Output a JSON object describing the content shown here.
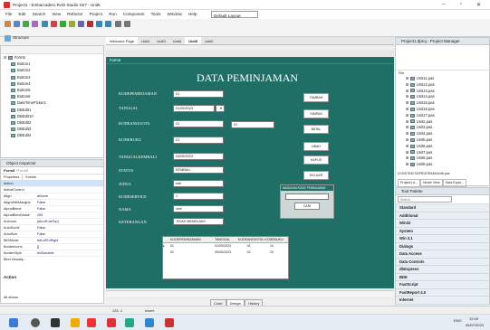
{
  "window": {
    "title": "Project1 - Embarcadero RAD Studio XE7 - Unit5"
  },
  "menu": [
    "File",
    "Edit",
    "Search",
    "View",
    "Refactor",
    "Project",
    "Run",
    "Component",
    "Tools",
    "Window",
    "Help"
  ],
  "toolbar": {
    "layout_combo": "Default Layout"
  },
  "tabs": [
    "Welcome Page",
    "Unit1",
    "Unit3",
    "Unit4",
    "Unit5",
    "Unit2"
  ],
  "structure": {
    "title": "Structure",
    "root": "Form5",
    "items": [
      "Button1",
      "Button2",
      "Button3",
      "Button4",
      "Button5",
      "Button6",
      "DateTimePicker1",
      "DBEdit1",
      "DBEdit10",
      "DBEdit2",
      "DBEdit3",
      "DBEdit4"
    ]
  },
  "inspector": {
    "title": "Object Inspector",
    "object": "Form5",
    "object_type": "TForm5",
    "tabs": [
      "Properties",
      "Events"
    ],
    "rows": [
      {
        "k": "Action",
        "v": ""
      },
      {
        "k": "ActiveControl",
        "v": ""
      },
      {
        "k": "Align",
        "v": "alNone"
      },
      {
        "k": "AlignWithMargins",
        "v": "False"
      },
      {
        "k": "AlphaBlend",
        "v": "False"
      },
      {
        "k": "AlphaBlendValue",
        "v": "255"
      },
      {
        "k": "Anchors",
        "v": "[akLeft,akTop]"
      },
      {
        "k": "AutoScroll",
        "v": "False"
      },
      {
        "k": "AutoSize",
        "v": "False"
      },
      {
        "k": "BiDiMode",
        "v": "bdLeftToRight"
      },
      {
        "k": "BorderIcons",
        "v": "[]"
      },
      {
        "k": "BorderStyle",
        "v": "bsSizeable"
      }
    ],
    "footer": "Bind Visually...",
    "action_label": "Action",
    "all_shown": "All shown"
  },
  "form": {
    "caption": "Form5",
    "heading": "DATA PEMINJAMAN",
    "labels": [
      "KODEPEMINJAMAN",
      "TANGGAL",
      "KODEANGGOTA",
      "KODEBUKU",
      "TANGGALKEMBALI",
      "STATUS",
      "JUDUL",
      "KODESERVICE",
      "NAMA",
      "KETERANGAN"
    ],
    "fields": {
      "kode_pinjam": "01",
      "tanggal": "01/05/2023",
      "kode_anggota": "01",
      "kode_anggota_nama": "01",
      "kode_buku": "01",
      "tanggal_kembali": "04/05/2023",
      "status": "KEMBALI",
      "judul": "mtk",
      "kode_service": "1",
      "nama": "veni",
      "keterangan": "TIDAK MEMINJAM"
    },
    "buttons": [
      "TAMBAH",
      "SIMPAN",
      "BATAL",
      "UBAH",
      "HAPUS",
      "KELUAR"
    ],
    "search": {
      "title": "MASUKAN KODE PEMINJAMAN",
      "button": "CARI"
    },
    "grid": {
      "columns": [
        "KODEPEMINJAMAN",
        "TANGGAL",
        "KODEANGGOTA",
        "KODEBUKU"
      ],
      "rows": [
        [
          "01",
          "01/05/2023",
          "01",
          "01"
        ],
        [
          "02",
          "05/05/2023",
          "02",
          "02"
        ]
      ]
    }
  },
  "editor_tabs": [
    "Code",
    "Design",
    "History"
  ],
  "status": {
    "position": "131: 1",
    "mode": "Insert"
  },
  "project_manager": {
    "title": "Project1.dproj - Project Manager",
    "file_label": "File",
    "files": [
      "Unit11.pas",
      "Unit12.pas",
      "Unit13.pas",
      "Unit14.pas",
      "Unit15.pas",
      "Unit16.pas",
      "Unit17.pas",
      "Unit2.pas",
      "Unit3.pas",
      "Unit4.pas",
      "Unit5.pas",
      "Unit6.pas",
      "Unit7.pas",
      "Unit8.pas",
      "Unit9.pas"
    ],
    "path": "D:\\SISTEM TA\\PROGRAM\\Unit5.pas",
    "tabs": [
      "Project1.d...",
      "Model View",
      "Data Explo..."
    ]
  },
  "palette": {
    "title": "Tool Palette",
    "search": "Search",
    "categories": [
      "Standard",
      "Additional",
      "Win32",
      "System",
      "Win 3.1",
      "Dialogs",
      "Data Access",
      "Data Controls",
      "dbExpress",
      "BDE",
      "FastScript",
      "FastReport 4.0",
      "Internet",
      "Samples"
    ]
  },
  "taskbar": {
    "time": "12:49",
    "date": "06/07/2023",
    "lang": "ENG"
  }
}
